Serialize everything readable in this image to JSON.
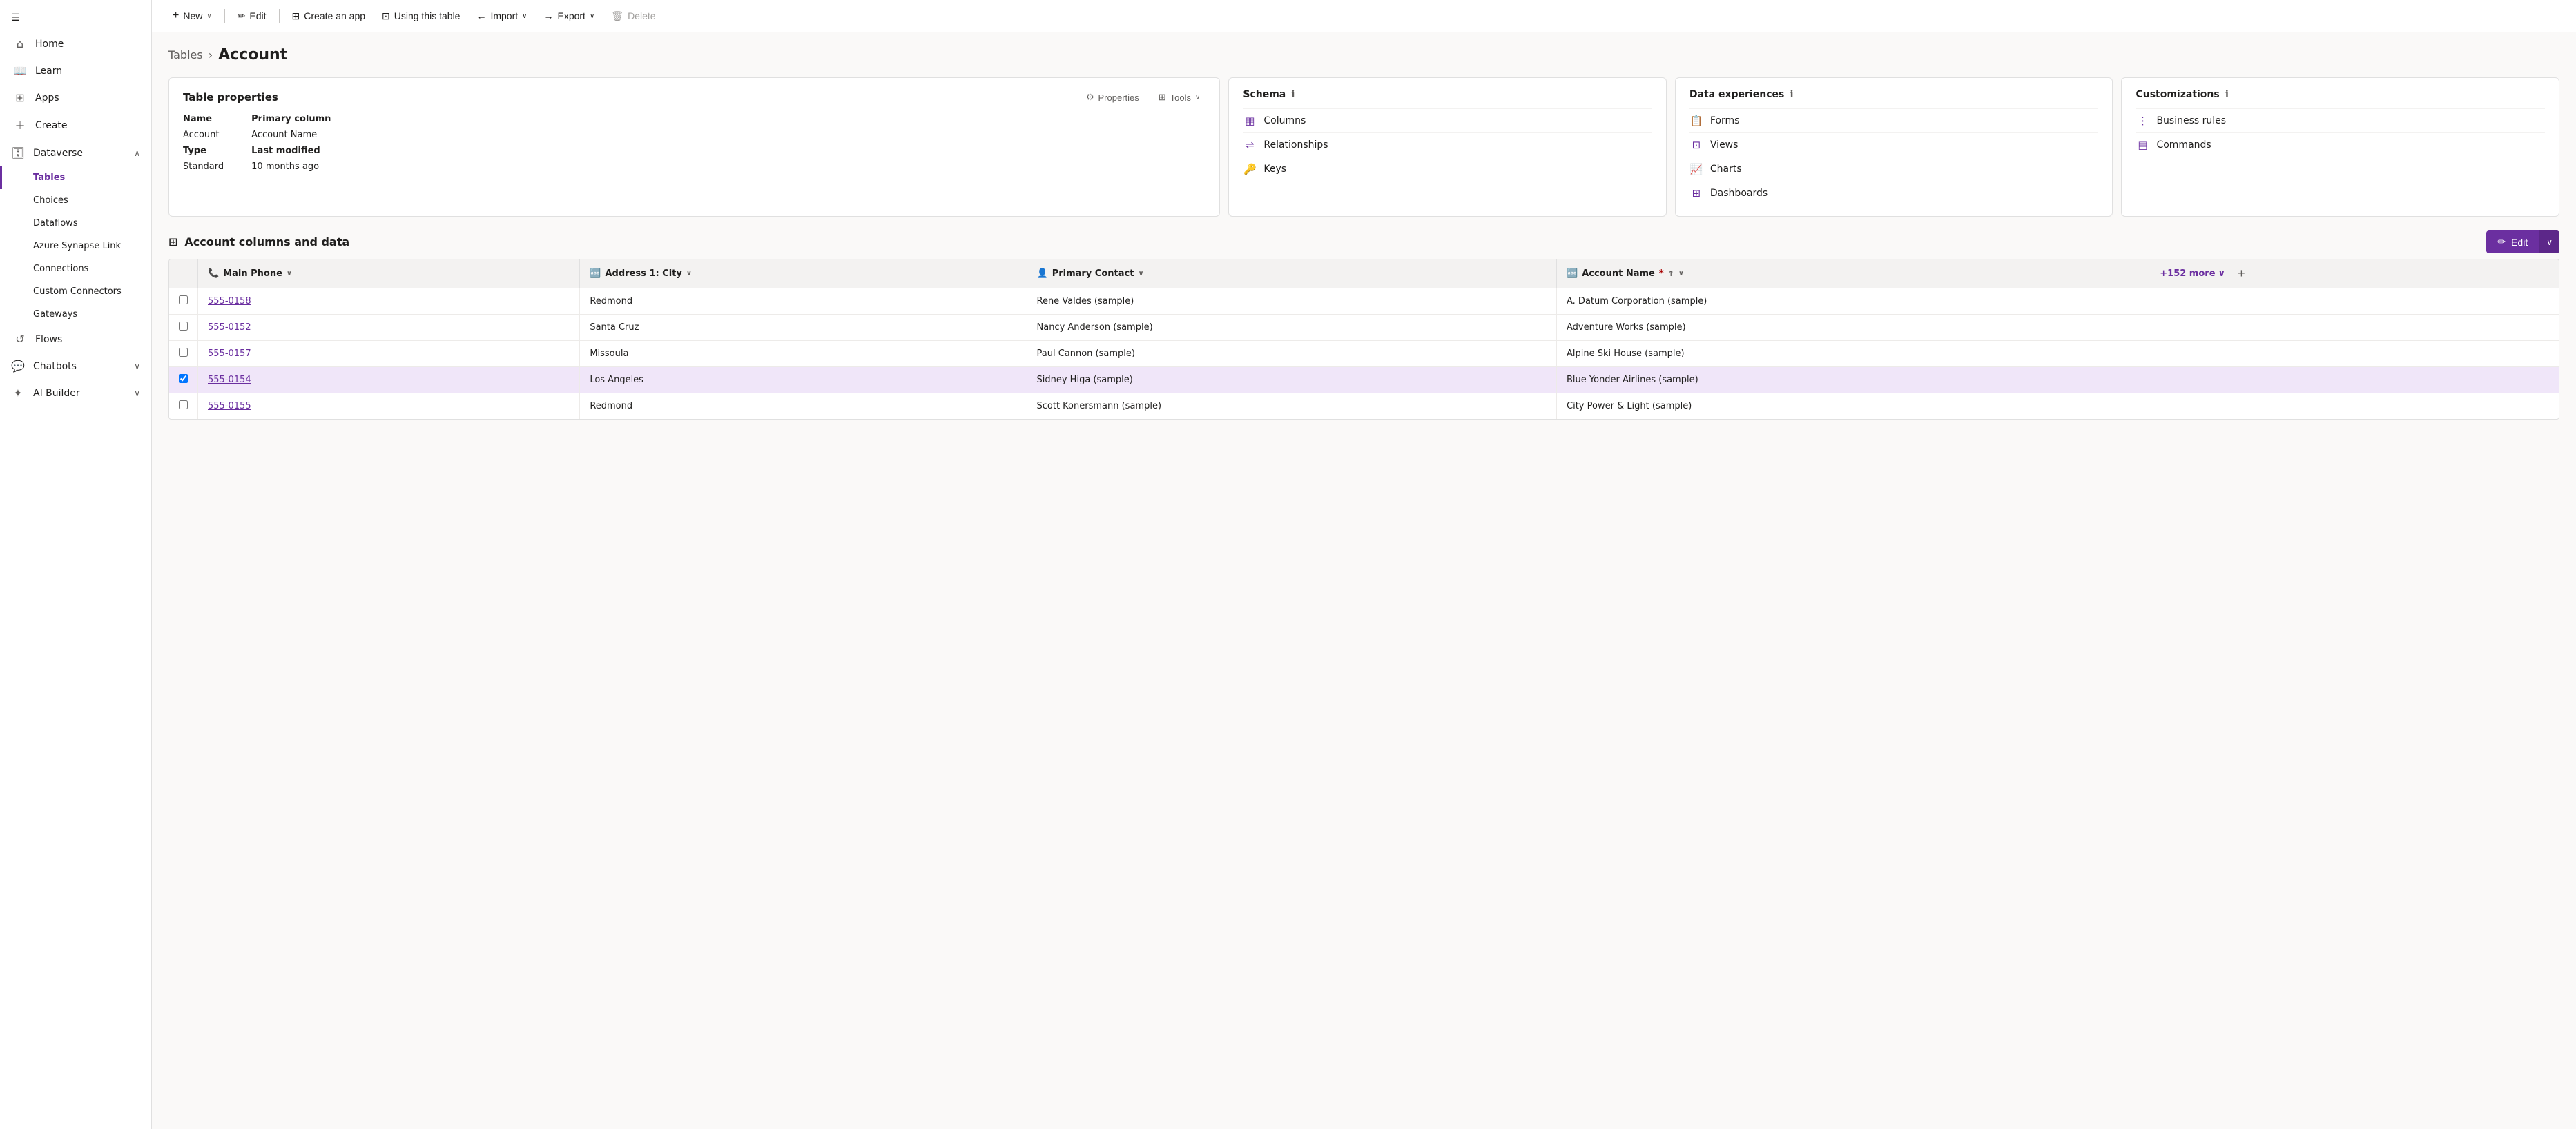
{
  "sidebar": {
    "hamburger_icon": "☰",
    "items": [
      {
        "id": "home",
        "label": "Home",
        "icon": "⌂",
        "type": "nav"
      },
      {
        "id": "learn",
        "label": "Learn",
        "icon": "📖",
        "type": "nav"
      },
      {
        "id": "apps",
        "label": "Apps",
        "icon": "⊞",
        "type": "nav"
      },
      {
        "id": "create",
        "label": "Create",
        "icon": "+",
        "type": "nav"
      },
      {
        "id": "dataverse",
        "label": "Dataverse",
        "icon": "🗄",
        "type": "section",
        "expanded": true,
        "children": [
          {
            "id": "tables",
            "label": "Tables",
            "active": true
          },
          {
            "id": "choices",
            "label": "Choices"
          },
          {
            "id": "dataflows",
            "label": "Dataflows"
          },
          {
            "id": "azure-synapse",
            "label": "Azure Synapse Link"
          },
          {
            "id": "connections",
            "label": "Connections"
          },
          {
            "id": "custom-connectors",
            "label": "Custom Connectors"
          },
          {
            "id": "gateways",
            "label": "Gateways"
          }
        ]
      },
      {
        "id": "flows",
        "label": "Flows",
        "icon": "↺",
        "type": "nav"
      },
      {
        "id": "chatbots",
        "label": "Chatbots",
        "icon": "💬",
        "type": "section",
        "expanded": true
      },
      {
        "id": "ai-builder",
        "label": "AI Builder",
        "icon": "✦",
        "type": "section",
        "expanded": true
      }
    ]
  },
  "toolbar": {
    "new_label": "New",
    "edit_label": "Edit",
    "create_app_label": "Create an app",
    "using_table_label": "Using this table",
    "import_label": "Import",
    "export_label": "Export",
    "delete_label": "Delete"
  },
  "breadcrumb": {
    "parent": "Tables",
    "current": "Account"
  },
  "table_properties_card": {
    "title": "Table properties",
    "properties_btn": "Properties",
    "tools_btn": "Tools",
    "name_label": "Name",
    "name_value": "Account",
    "type_label": "Type",
    "type_value": "Standard",
    "primary_column_label": "Primary column",
    "primary_column_value": "Account Name",
    "last_modified_label": "Last modified",
    "last_modified_value": "10 months ago"
  },
  "schema_card": {
    "title": "Schema",
    "info": true,
    "items": [
      {
        "id": "columns",
        "label": "Columns",
        "icon": "▦"
      },
      {
        "id": "relationships",
        "label": "Relationships",
        "icon": "⇌"
      },
      {
        "id": "keys",
        "label": "Keys",
        "icon": "🔑"
      }
    ]
  },
  "data_experiences_card": {
    "title": "Data experiences",
    "info": true,
    "items": [
      {
        "id": "forms",
        "label": "Forms",
        "icon": "📋"
      },
      {
        "id": "views",
        "label": "Views",
        "icon": "⊡"
      },
      {
        "id": "charts",
        "label": "Charts",
        "icon": "📈"
      },
      {
        "id": "dashboards",
        "label": "Dashboards",
        "icon": "⊞"
      }
    ]
  },
  "customizations_card": {
    "title": "Customizations",
    "info": true,
    "items": [
      {
        "id": "business-rules",
        "label": "Business rules",
        "icon": "⋮"
      },
      {
        "id": "commands",
        "label": "Commands",
        "icon": "▤"
      }
    ]
  },
  "data_section": {
    "title": "Account columns and data",
    "edit_label": "Edit",
    "columns": [
      {
        "id": "main-phone",
        "label": "Main Phone",
        "icon": "📞",
        "sortable": true
      },
      {
        "id": "address-city",
        "label": "Address 1: City",
        "icon": "🔤",
        "sortable": true
      },
      {
        "id": "primary-contact",
        "label": "Primary Contact",
        "icon": "👤",
        "sortable": true
      },
      {
        "id": "account-name",
        "label": "Account Name",
        "icon": "🔤",
        "required": true,
        "sorted": true,
        "sortDir": "asc"
      }
    ],
    "more_columns_label": "+152 more",
    "rows": [
      {
        "id": 1,
        "phone": "555-0158",
        "city": "Redmond",
        "contact": "Rene Valdes (sample)",
        "account": "A. Datum Corporation (sample)",
        "selected": false
      },
      {
        "id": 2,
        "phone": "555-0152",
        "city": "Santa Cruz",
        "contact": "Nancy Anderson (sample)",
        "account": "Adventure Works (sample)",
        "selected": false
      },
      {
        "id": 3,
        "phone": "555-0157",
        "city": "Missoula",
        "contact": "Paul Cannon (sample)",
        "account": "Alpine Ski House (sample)",
        "selected": false
      },
      {
        "id": 4,
        "phone": "555-0154",
        "city": "Los Angeles",
        "contact": "Sidney Higa (sample)",
        "account": "Blue Yonder Airlines (sample)",
        "selected": true
      },
      {
        "id": 5,
        "phone": "555-0155",
        "city": "Redmond",
        "contact": "Scott Konersmann (sample)",
        "account": "City Power & Light (sample)",
        "selected": false
      }
    ]
  },
  "colors": {
    "accent": "#6b2fa0",
    "accent_hover": "#5c2789"
  }
}
